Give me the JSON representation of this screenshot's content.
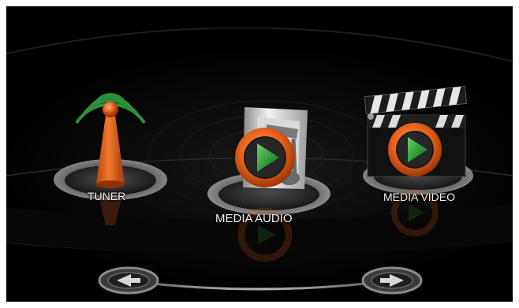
{
  "menu": {
    "items": [
      {
        "id": "tuner",
        "label": "TUNER",
        "icon": "antenna-icon"
      },
      {
        "id": "media_audio",
        "label": "MEDIA AUDIO",
        "icon": "music-note-play-icon"
      },
      {
        "id": "media_video",
        "label": "MEDIA VIDEO",
        "icon": "clapperboard-play-icon"
      }
    ],
    "selected": "media_audio"
  },
  "navigation": {
    "previous_icon": "arrow-left-icon",
    "next_icon": "arrow-right-icon"
  },
  "colors": {
    "background": "#000000",
    "frame": "#ffffff",
    "accent_orange": "#e8621c",
    "play_green": "#2f9a3a",
    "signal_green": "#2d8f3c",
    "label_text": "#f2f2f2"
  }
}
